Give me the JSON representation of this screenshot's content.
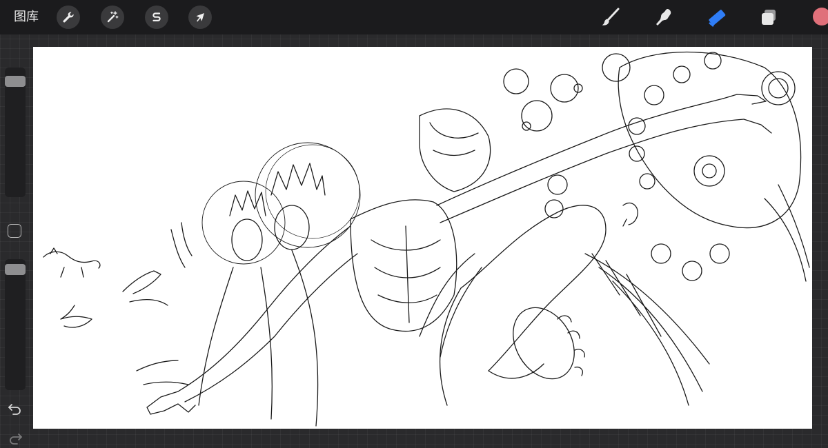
{
  "toolbar": {
    "gallery_label": "图库",
    "left_tools": [
      {
        "name": "actions",
        "icon": "wrench-icon"
      },
      {
        "name": "adjustments",
        "icon": "magic-wand-icon"
      },
      {
        "name": "selection",
        "icon": "selection-s-icon"
      },
      {
        "name": "transform",
        "icon": "arrow-cursor-icon"
      }
    ],
    "right_tools": [
      {
        "name": "brush",
        "icon": "brush-icon"
      },
      {
        "name": "smudge",
        "icon": "smudge-finger-icon"
      },
      {
        "name": "eraser",
        "icon": "eraser-icon",
        "active": true,
        "color": "#2f7df6"
      },
      {
        "name": "layers",
        "icon": "layers-icon"
      }
    ],
    "current_color": "#e0707a"
  },
  "sidebar": {
    "brush_size_level": 0.95,
    "opacity_level": 0.98,
    "modify_icon": "square-icon",
    "undo_icon": "undo-arrow-icon",
    "redo_icon": "redo-arrow-icon"
  },
  "canvas": {
    "background": "#ffffff",
    "artwork": "line-art-drawing"
  },
  "colors": {
    "topbar": "#1b1b1d",
    "workspace": "#2a2a2c",
    "accent": "#2f7df6"
  }
}
